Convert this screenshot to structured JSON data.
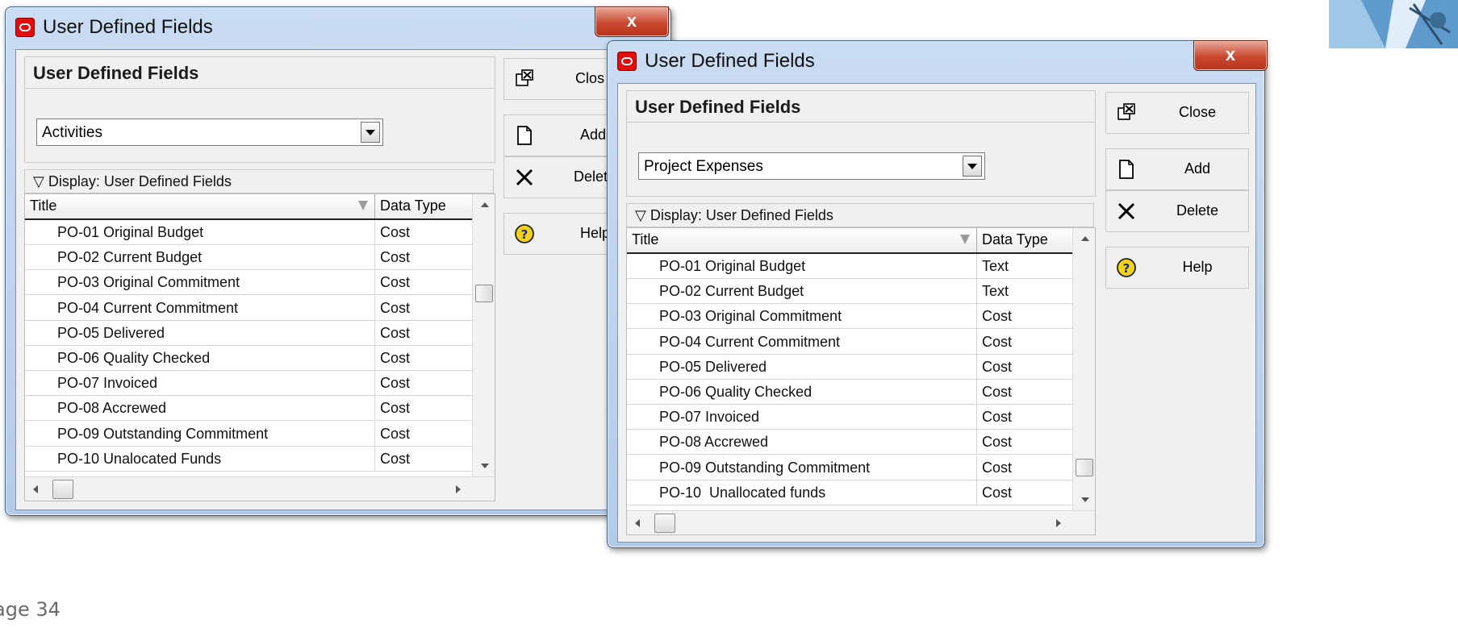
{
  "page_footer": "age 34",
  "window1": {
    "title": "User Defined Fields",
    "close_glyph": "x",
    "panel_title": "User Defined Fields",
    "subject_selected": "Activities",
    "display_label": "▽ Display: User Defined Fields",
    "columns": {
      "title": "Title",
      "data_type": "Data Type"
    },
    "rows": [
      {
        "title": "PO-01 Original Budget",
        "type": "Cost"
      },
      {
        "title": "PO-02 Current Budget",
        "type": "Cost"
      },
      {
        "title": "PO-03 Original Commitment",
        "type": "Cost"
      },
      {
        "title": "PO-04 Current Commitment",
        "type": "Cost"
      },
      {
        "title": "PO-05 Delivered",
        "type": "Cost"
      },
      {
        "title": "PO-06 Quality Checked",
        "type": "Cost"
      },
      {
        "title": "PO-07 Invoiced",
        "type": "Cost"
      },
      {
        "title": "PO-08 Accrewed",
        "type": "Cost"
      },
      {
        "title": "PO-09 Outstanding Commitment",
        "type": "Cost"
      },
      {
        "title": "PO-10 Unalocated Funds",
        "type": "Cost"
      }
    ],
    "buttons": {
      "close": "Clos",
      "add": "Add",
      "delete": "Delet",
      "help": "Help"
    }
  },
  "window2": {
    "title": "User Defined Fields",
    "close_glyph": "x",
    "panel_title": "User Defined Fields",
    "subject_selected": "Project Expenses",
    "display_label": "▽ Display: User Defined Fields",
    "columns": {
      "title": "Title",
      "data_type": "Data Type"
    },
    "rows": [
      {
        "title": "PO-01 Original Budget",
        "type": "Text"
      },
      {
        "title": "PO-02 Current Budget",
        "type": "Text"
      },
      {
        "title": "PO-03 Original Commitment",
        "type": "Cost"
      },
      {
        "title": "PO-04 Current Commitment",
        "type": "Cost"
      },
      {
        "title": "PO-05 Delivered",
        "type": "Cost"
      },
      {
        "title": "PO-06 Quality Checked",
        "type": "Cost"
      },
      {
        "title": "PO-07 Invoiced",
        "type": "Cost"
      },
      {
        "title": "PO-08 Accrewed",
        "type": "Cost"
      },
      {
        "title": "PO-09 Outstanding Commitment",
        "type": "Cost"
      },
      {
        "title": "PO-10  Unallocated funds",
        "type": "Cost"
      }
    ],
    "buttons": {
      "close": "Close",
      "add": "Add",
      "delete": "Delete",
      "help": "Help"
    }
  },
  "icons": {
    "close": "close-window-icon",
    "add": "new-document-icon",
    "delete": "delete-x-icon",
    "help": "help-question-icon",
    "app": "oracle-primavera-icon"
  },
  "colors": {
    "titlebar": "#b4cbe8",
    "close_button": "#c9482f",
    "help_icon": "#f4d21b",
    "app_icon": "#e30d0d"
  }
}
